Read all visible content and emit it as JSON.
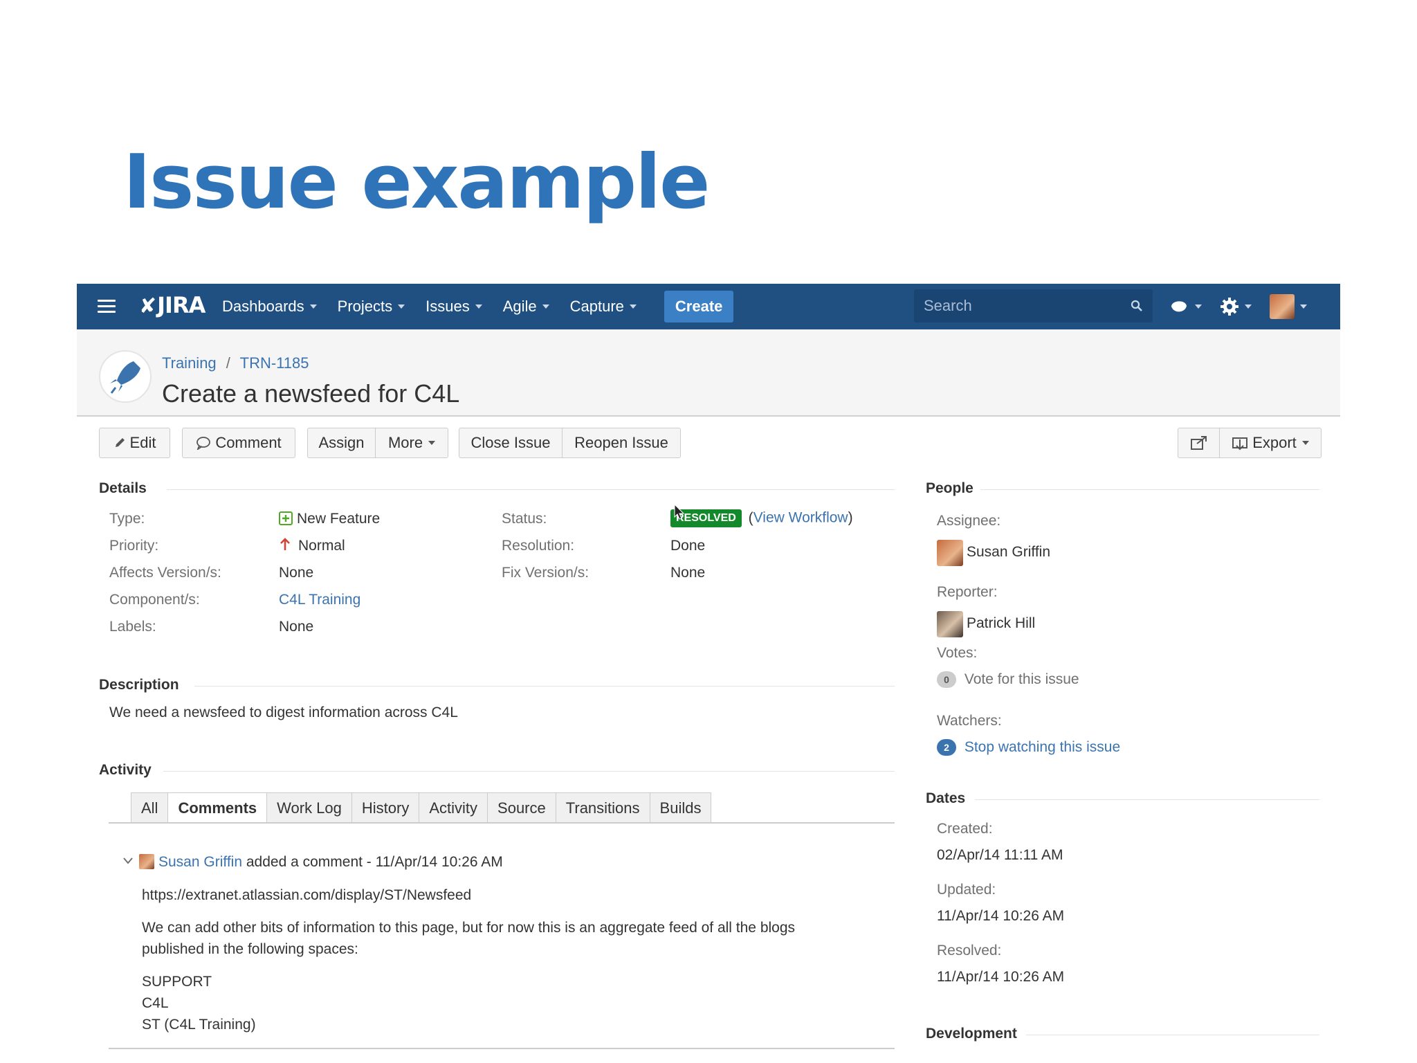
{
  "slide": {
    "title": "Issue example"
  },
  "nav": {
    "items": [
      "Dashboards",
      "Projects",
      "Issues",
      "Agile",
      "Capture"
    ],
    "create_label": "Create",
    "search_placeholder": "Search",
    "logo_text": "JIRA",
    "brand_color": "#205081"
  },
  "breadcrumb": {
    "project": "Training",
    "separator": "/",
    "key": "TRN-1185"
  },
  "issue": {
    "title": "Create a newsfeed for C4L"
  },
  "toolbar": {
    "edit": "Edit",
    "comment": "Comment",
    "assign": "Assign",
    "more": "More",
    "close_issue": "Close Issue",
    "reopen_issue": "Reopen Issue",
    "export": "Export"
  },
  "details": {
    "heading": "Details",
    "type_label": "Type:",
    "type_value": "New Feature",
    "priority_label": "Priority:",
    "priority_value": "Normal",
    "affects_label": "Affects Version/s:",
    "affects_value": "None",
    "components_label": "Component/s:",
    "components_value": "C4L Training",
    "labels_label": "Labels:",
    "labels_value": "None",
    "status_label": "Status:",
    "status_value": "RESOLVED",
    "status_color": "#14892c",
    "view_workflow": "View Workflow",
    "resolution_label": "Resolution:",
    "resolution_value": "Done",
    "fix_label": "Fix Version/s:",
    "fix_value": "None"
  },
  "description": {
    "heading": "Description",
    "text": "We need a newsfeed to digest information across C4L"
  },
  "activity": {
    "heading": "Activity",
    "tabs": [
      "All",
      "Comments",
      "Work Log",
      "History",
      "Activity",
      "Source",
      "Transitions",
      "Builds"
    ],
    "active_tab": "Comments",
    "comment": {
      "author": "Susan Griffin",
      "meta": "added a comment - 11/Apr/14 10:26 AM",
      "link": "https://extranet.atlassian.com/display/ST/Newsfeed",
      "para_line1": "We can add other bits of information to this page, but for now this is an aggregate feed of all the blogs",
      "para_line2": "published in the following spaces:",
      "list": [
        "SUPPORT",
        "C4L",
        "ST (C4L Training)"
      ]
    }
  },
  "people": {
    "heading": "People",
    "assignee_label": "Assignee:",
    "assignee": "Susan Griffin",
    "reporter_label": "Reporter:",
    "reporter": "Patrick Hill",
    "votes_label": "Votes:",
    "votes_count": "0",
    "vote_text": "Vote for this issue",
    "watchers_label": "Watchers:",
    "watchers_count": "2",
    "watch_text": "Stop watching this issue"
  },
  "dates": {
    "heading": "Dates",
    "created_label": "Created:",
    "created": "02/Apr/14 11:11 AM",
    "updated_label": "Updated:",
    "updated": "11/Apr/14 10:26 AM",
    "resolved_label": "Resolved:",
    "resolved": "11/Apr/14 10:26 AM"
  },
  "development": {
    "heading": "Development"
  }
}
